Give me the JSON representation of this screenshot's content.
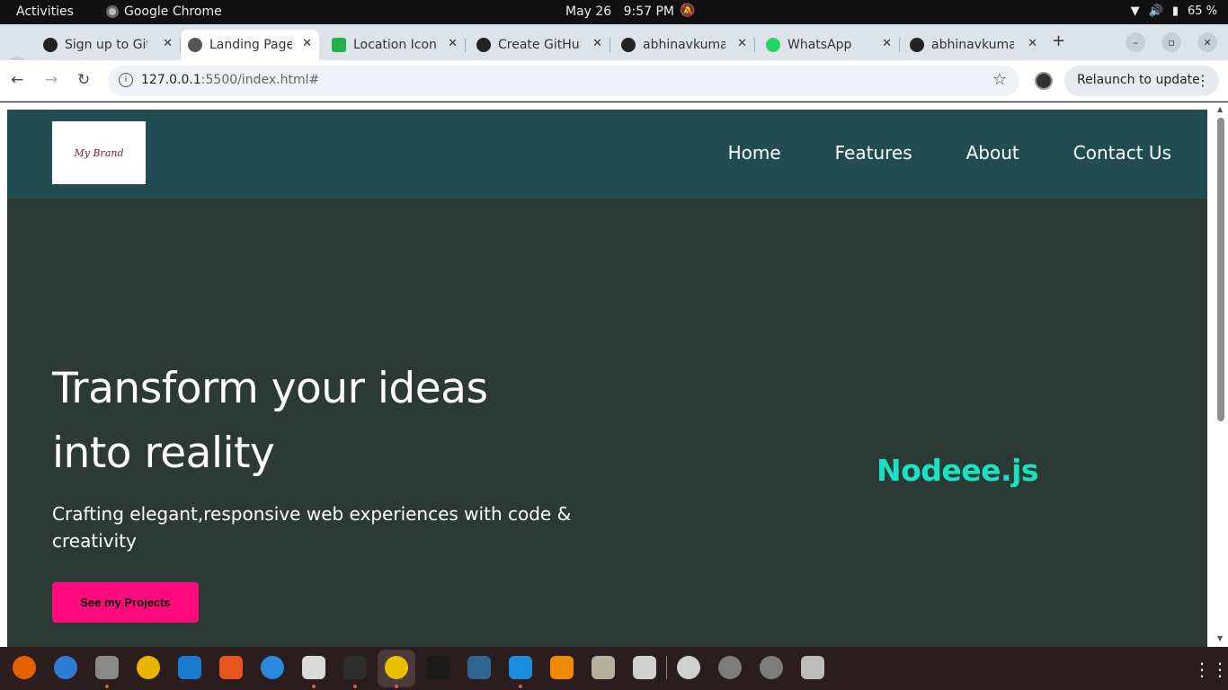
{
  "system": {
    "activities": "Activities",
    "app_name": "Google Chrome",
    "date": "May 26",
    "time": "9:57 PM",
    "battery": "65 %"
  },
  "tabs": [
    {
      "title": "Sign up to GitHub",
      "icon": "github-icon",
      "active": false
    },
    {
      "title": "Landing Page",
      "icon": "globe-icon",
      "active": true
    },
    {
      "title": "Location Icon",
      "icon": "green-square-icon",
      "active": false
    },
    {
      "title": "Create GitHub",
      "icon": "openai-icon",
      "active": false
    },
    {
      "title": "abhinavkumar",
      "icon": "github-icon",
      "active": false
    },
    {
      "title": "WhatsApp",
      "icon": "whatsapp-icon",
      "active": false
    },
    {
      "title": "abhinavkumar",
      "icon": "github-icon",
      "active": false
    }
  ],
  "address_bar": {
    "url_host": "127.0.0.1",
    "url_rest": ":5500/index.html#",
    "relaunch_label": "Relaunch to update"
  },
  "site": {
    "logo_text": "My Brand",
    "nav": [
      "Home",
      "Features",
      "About",
      "Contact Us"
    ],
    "hero_title": "Transform your ideas into reality",
    "hero_subtitle": "Crafting elegant,responsive web experiences with code & creativity",
    "cta_label": "See my Projects",
    "brand_text": "Nodeee.js",
    "colors": {
      "nav_bg": "#214d52",
      "hero_bg": "#2c3a35",
      "cta": "#ff0a7e",
      "accent": "#18e2c1"
    }
  },
  "dock": [
    {
      "name": "firefox-icon",
      "color": "#e66000",
      "running": false
    },
    {
      "name": "thunderbird-icon",
      "color": "#2f7bd8",
      "running": false
    },
    {
      "name": "files-icon",
      "color": "#8a8a8a",
      "running": true
    },
    {
      "name": "rhythmbox-icon",
      "color": "#e8b400",
      "running": false
    },
    {
      "name": "writer-icon",
      "color": "#1d7ad1",
      "running": false
    },
    {
      "name": "app-center-icon",
      "color": "#e95420",
      "running": false
    },
    {
      "name": "help-icon",
      "color": "#2a8ae0",
      "running": false
    },
    {
      "name": "text-editor-icon",
      "color": "#d9d9d9",
      "running": true
    },
    {
      "name": "terminal-icon",
      "color": "#2e2e2e",
      "running": true
    },
    {
      "name": "chrome-icon",
      "color": "#e8c000",
      "running": true
    },
    {
      "name": "player-icon",
      "color": "#1a1a1a",
      "running": false
    },
    {
      "name": "mysql-icon",
      "color": "#2e6690",
      "running": false
    },
    {
      "name": "vscode-icon",
      "color": "#1b8cde",
      "running": true
    },
    {
      "name": "vlc-icon",
      "color": "#f08a00",
      "running": false
    },
    {
      "name": "archive-icon",
      "color": "#b5b09c",
      "running": false
    },
    {
      "name": "screenshot-icon",
      "color": "#d0d0d0",
      "running": false
    },
    {
      "name": "disk-icon",
      "color": "#d0d0d0",
      "running": false
    },
    {
      "name": "drive-icon-1",
      "color": "#7c7c7c",
      "running": false
    },
    {
      "name": "drive-icon-2",
      "color": "#7c7c7c",
      "running": false
    },
    {
      "name": "trash-icon",
      "color": "#bcbcbc",
      "running": false
    }
  ]
}
